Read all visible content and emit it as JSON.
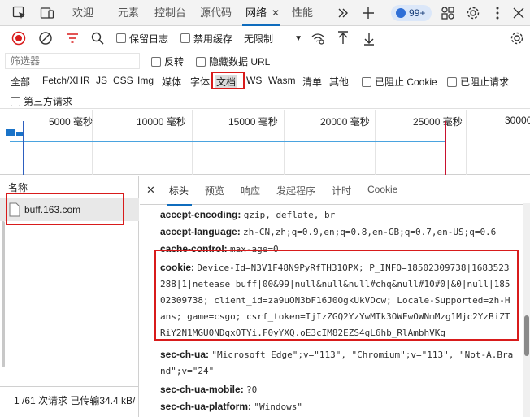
{
  "tabs": [
    {
      "label": "欢迎"
    },
    {
      "label": "元素"
    },
    {
      "label": "控制台"
    },
    {
      "label": "源代码"
    },
    {
      "label": "网络",
      "active": true
    },
    {
      "label": "性能"
    }
  ],
  "issues_badge": "99+",
  "toolbar": {
    "preserve_log": "保留日志",
    "disable_cache": "禁用缓存",
    "throttling": "无限制"
  },
  "filter": {
    "placeholder": "筛选器",
    "invert": "反转",
    "hide_data_urls": "隐藏数据 URL"
  },
  "type_filters": [
    "全部",
    "Fetch/XHR",
    "JS",
    "CSS",
    "Img",
    "媒体",
    "字体",
    "文档",
    "WS",
    "Wasm",
    "清单",
    "其他"
  ],
  "active_type_filter": "文档",
  "blocked_cookies": "已阻止 Cookie",
  "blocked_requests": "已阻止请求",
  "third_party": "第三方请求",
  "overview_ticks": [
    "5000 毫秒",
    "10000 毫秒",
    "15000 毫秒",
    "20000 毫秒",
    "25000 毫秒",
    "30000"
  ],
  "request_list": {
    "column_name": "名称",
    "items": [
      {
        "name": "buff.163.com"
      }
    ]
  },
  "status_bar": "1 /61 次请求  已传输34.4 kB/",
  "detail_tabs": [
    "标头",
    "预览",
    "响应",
    "发起程序",
    "计时",
    "Cookie"
  ],
  "headers": [
    {
      "key": "accept-encoding:",
      "value": "gzip, deflate, br"
    },
    {
      "key": "accept-language:",
      "value": "zh-CN,zh;q=0.9,en;q=0.8,en-GB;q=0.7,en-US;q=0.6"
    },
    {
      "key": "cache-control:",
      "value": "max-age=0"
    },
    {
      "key": "cookie:",
      "value_lines": [
        "Device-Id=N3V1F48N9PyRfTH31OPX; P_INFO=18502309738|1683523",
        "288|1|netease_buff|00&99|null&null&null#chq&null#10#0|&0|null|185",
        "02309738; client_id=za9uON3bF16J0OgkUkVDcw; Locale-Supported=zh-H",
        "ans; game=csgo; csrf_token=IjIzZGQ2YzYwMTk3OWEwOWNmMzg1Mjc2YzBiZT",
        "RiY2N1MGU0NDgxOTYi.F0yYXQ.oE3cIM82EZS4gL6hb_RlAmbhVKg"
      ]
    },
    {
      "key": "sec-ch-ua:",
      "value_lines": [
        "\"Microsoft Edge\";v=\"113\", \"Chromium\";v=\"113\", \"Not-A.Bra",
        "nd\";v=\"24\""
      ]
    },
    {
      "key": "sec-ch-ua-mobile:",
      "value": "?0"
    },
    {
      "key": "sec-ch-ua-platform:",
      "value": "\"Windows\""
    }
  ]
}
